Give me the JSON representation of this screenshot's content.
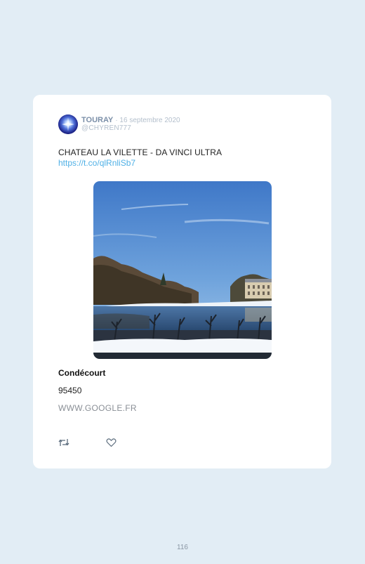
{
  "tweet": {
    "author_name": "TOURAY",
    "date": "· 16 septembre 2020",
    "handle": "@CHYREN777",
    "text": "CHATEAU LA VILETTE - DA VINCI ULTRA",
    "link": "https://t.co/qlRnliSb7"
  },
  "location": {
    "name": "Condécourt",
    "postal_code": "95450",
    "website": "WWW.GOOGLE.FR"
  },
  "actions": {
    "retweet_icon": "retweet-icon",
    "like_icon": "heart-icon"
  },
  "page": {
    "number": "116"
  },
  "colors": {
    "background": "#e2edf5",
    "card": "#ffffff",
    "link": "#4fb0e6"
  }
}
